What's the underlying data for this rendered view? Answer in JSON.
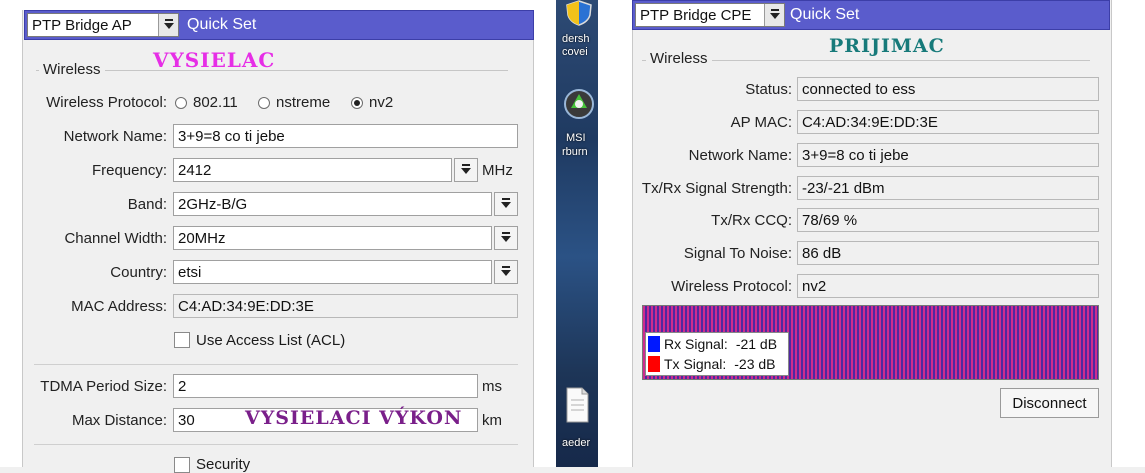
{
  "left": {
    "mode_value": "PTP Bridge AP",
    "quickset_label": "Quick Set",
    "wireless_title": "Wireless",
    "overlay_title": "VYSIELAC",
    "protocol": {
      "label": "Wireless Protocol:",
      "options": [
        "802.11",
        "nstreme",
        "nv2"
      ],
      "selected": "nv2"
    },
    "network_name": {
      "label": "Network Name:",
      "value": "3+9=8 co ti jebe"
    },
    "frequency": {
      "label": "Frequency:",
      "value": "2412",
      "unit": "MHz"
    },
    "band": {
      "label": "Band:",
      "value": "2GHz-B/G"
    },
    "channel_width": {
      "label": "Channel Width:",
      "value": "20MHz"
    },
    "country": {
      "label": "Country:",
      "value": "etsi"
    },
    "mac_address": {
      "label": "MAC Address:",
      "value": "C4:AD:34:9E:DD:3E"
    },
    "acl": {
      "label": "Use Access List (ACL)"
    },
    "tdma_period": {
      "label": "TDMA Period Size:",
      "value": "2",
      "unit": "ms"
    },
    "max_distance": {
      "label": "Max Distance:",
      "value": "30",
      "unit": "km"
    },
    "overlay_power": "VYSIELACI VÝKON",
    "security": {
      "label": "Security"
    }
  },
  "desktop": {
    "icon1_label_a": "dersh",
    "icon1_label_b": "covei",
    "icon2_label_a": "MSI",
    "icon2_label_b": "rburn",
    "icon3_label": "aeder"
  },
  "right": {
    "mode_value": "PTP Bridge CPE",
    "quickset_label": "Quick Set",
    "overlay_title": "PRIJIMAC",
    "wireless_title": "Wireless",
    "status": {
      "label": "Status:",
      "value": "connected to ess"
    },
    "ap_mac": {
      "label": "AP MAC:",
      "value": "C4:AD:34:9E:DD:3E"
    },
    "network_name": {
      "label": "Network Name:",
      "value": "3+9=8 co ti jebe"
    },
    "signal_strength": {
      "label": "Tx/Rx Signal Strength:",
      "value": "-23/-21 dBm"
    },
    "ccq": {
      "label": "Tx/Rx CCQ:",
      "value": "78/69 %"
    },
    "snr": {
      "label": "Signal To Noise:",
      "value": "86 dB"
    },
    "protocol": {
      "label": "Wireless Protocol:",
      "value": "nv2"
    },
    "legend": {
      "rx_label": "Rx Signal:",
      "rx_value": "-21 dB",
      "tx_label": "Tx Signal:",
      "tx_value": "-23 dB"
    },
    "disconnect_label": "Disconnect"
  },
  "colors": {
    "quickset_bar": "#5a5ccc",
    "overlay_magenta": "#e62ee6",
    "overlay_teal": "#177a7a",
    "overlay_purple": "#7a1f8a",
    "rx": "#0018ff",
    "tx": "#ff0000"
  }
}
